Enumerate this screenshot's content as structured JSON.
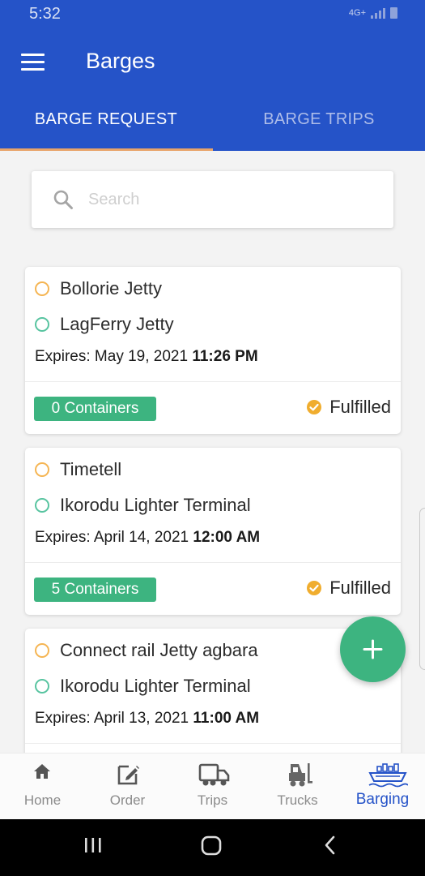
{
  "status_bar": {
    "time": "5:32",
    "network": "4G+"
  },
  "app_bar": {
    "title": "Barges"
  },
  "tabs": [
    {
      "label": "BARGE REQUEST",
      "active": true
    },
    {
      "label": "BARGE TRIPS",
      "active": false
    }
  ],
  "search": {
    "placeholder": "Search",
    "value": ""
  },
  "requests": [
    {
      "origin": "Bollorie Jetty",
      "destination": "LagFerry Jetty",
      "expires_label": "Expires:",
      "expires_date": "May 19, 2021",
      "expires_time": "11:26 PM",
      "containers": "0 Containers",
      "status": "Fulfilled"
    },
    {
      "origin": "Timetell",
      "destination": "Ikorodu Lighter Terminal",
      "expires_label": "Expires:",
      "expires_date": "April 14, 2021",
      "expires_time": "12:00 AM",
      "containers": "5 Containers",
      "status": "Fulfilled"
    },
    {
      "origin": "Connect rail Jetty agbara",
      "destination": "Ikorodu Lighter Terminal",
      "expires_label": "Expires:",
      "expires_date": "April 13, 2021",
      "expires_time": "11:00 AM"
    }
  ],
  "fab": {
    "icon": "plus-icon"
  },
  "bottom_nav": [
    {
      "label": "Home",
      "icon": "home-icon",
      "active": false
    },
    {
      "label": "Order",
      "icon": "edit-icon",
      "active": false
    },
    {
      "label": "Trips",
      "icon": "truck-icon",
      "active": false
    },
    {
      "label": "Trucks",
      "icon": "forklift-icon",
      "active": false
    },
    {
      "label": "Barging",
      "icon": "ship-icon",
      "active": true
    }
  ],
  "colors": {
    "primary": "#2553c8",
    "accent_green": "#3db480",
    "tab_indicator": "#e8a46a",
    "origin_dot": "#f5b553",
    "destination_dot": "#58c4a0",
    "fulfilled_check": "#f0ad2e"
  }
}
